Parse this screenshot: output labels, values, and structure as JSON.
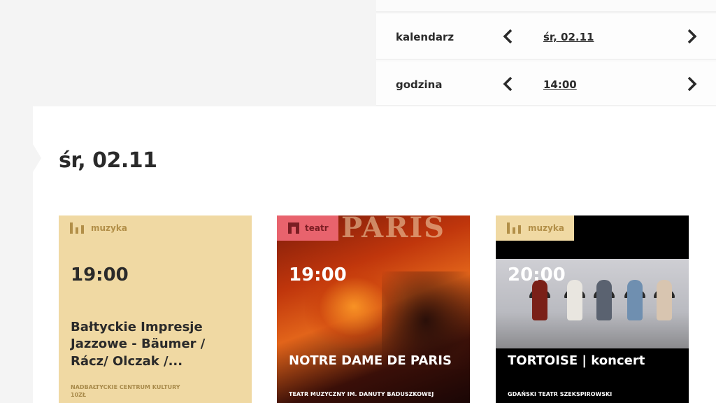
{
  "filters": {
    "calendar": {
      "label": "kalendarz",
      "value": "śr, 02.11"
    },
    "hour": {
      "label": "godzina",
      "value": "14:00"
    }
  },
  "date_heading": "śr, 02.11",
  "events": [
    {
      "category": "muzyka",
      "category_icon": "bars-icon",
      "time": "19:00",
      "title": "Bałtyckie Impresje Jazzowe - Bäumer / Rácz/ Olczak /...",
      "venue": "NADBAŁTYCKIE CENTRUM KULTURY",
      "price": "10ZŁ"
    },
    {
      "category": "teatr",
      "category_icon": "stage-icon",
      "time": "19:00",
      "title": "NOTRE DAME DE PARIS",
      "venue": "TEATR MUZYCZNY IM. DANUTY BADUSZKOWEJ",
      "poster_text": "PARIS"
    },
    {
      "category": "muzyka",
      "category_icon": "bars-icon",
      "time": "20:00",
      "title": "TORTOISE | koncert",
      "venue": "GDAŃSKI TEATR SZEKSPIROWSKI"
    }
  ],
  "colors": {
    "music_badge": "#f0d9a3",
    "theatre_badge": "#e8636d",
    "background": "#f4f4f4"
  }
}
